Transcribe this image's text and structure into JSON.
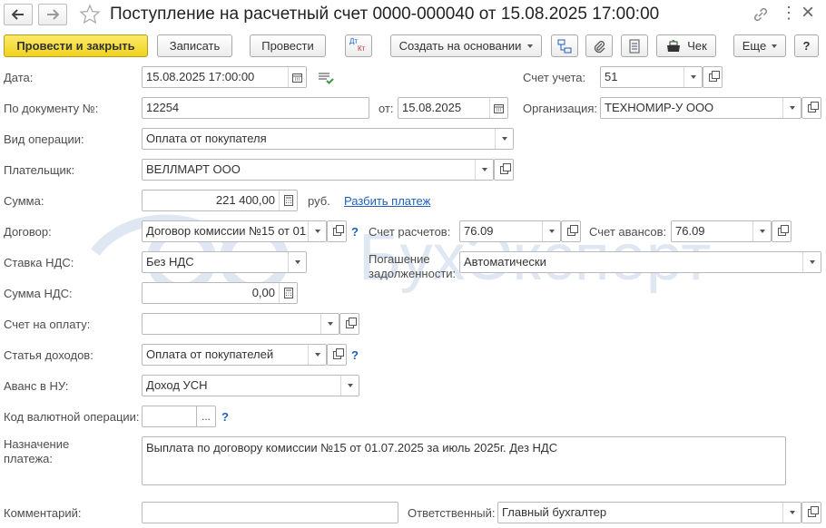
{
  "window": {
    "title": "Поступление на расчетный счет 0000-000040 от 15.08.2025 17:00:00",
    "menu_glyph": "⋮",
    "close_glyph": "×"
  },
  "toolbar": {
    "post_close": "Провести и закрыть",
    "save": "Записать",
    "post": "Провести",
    "dtkt_dt": "Дт",
    "dtkt_kt": "Кт",
    "create_based": "Создать на основании",
    "receipt": "Чек",
    "more": "Еще",
    "help": "?"
  },
  "form": {
    "date_label": "Дата:",
    "date_value": "15.08.2025 17:00:00",
    "account_label": "Счет учета:",
    "account_value": "51",
    "doc_num_label": "По документу №:",
    "doc_num_value": "12254",
    "from_label": "от:",
    "from_value": "15.08.2025",
    "org_label": "Организация:",
    "org_value": "ТЕХНОМИР-У ООО",
    "op_type_label": "Вид операции:",
    "op_type_value": "Оплата от покупателя",
    "payer_label": "Плательщик:",
    "payer_value": "ВЕЛЛМАРТ ООО",
    "sum_label": "Сумма:",
    "sum_value": "221 400,00",
    "currency": "руб.",
    "split_link": "Разбить платеж",
    "contract_label": "Договор:",
    "contract_value": "Договор комиссии №15 от 01",
    "settle_acc_label": "Счет расчетов:",
    "settle_acc_value": "76.09",
    "advance_acc_label": "Счет авансов:",
    "advance_acc_value": "76.09",
    "vat_rate_label": "Ставка НДС:",
    "vat_rate_value": "Без НДС",
    "debt_label_1": "Погашение",
    "debt_label_2": "задолженности:",
    "debt_value": "Автоматически",
    "vat_sum_label": "Сумма НДС:",
    "vat_sum_value": "0,00",
    "invoice_label": "Счет на оплату:",
    "invoice_value": "",
    "income_item_label": "Статья доходов:",
    "income_item_value": "Оплата от покупателей",
    "advance_nu_label": "Аванс в НУ:",
    "advance_nu_value": "Доход УСН",
    "currency_op_label": "Код валютной операции:",
    "currency_op_value": "",
    "ellipsis": "...",
    "purpose_label_1": "Назначение",
    "purpose_label_2": "платежа:",
    "purpose_value": "Выплата по договору комиссии №15 от 01.07.2025 за июль 2025г. Дез НДС",
    "comment_label": "Комментарий:",
    "comment_value": "",
    "responsible_label": "Ответственный:",
    "responsible_value": "Главный бухгалтер",
    "help_mark": "?"
  },
  "watermark_text": "БухЭксперт",
  "colors": {
    "primary_button": "#f0d31d",
    "link": "#1f5fbf",
    "watermark": "#dfe7f3"
  }
}
